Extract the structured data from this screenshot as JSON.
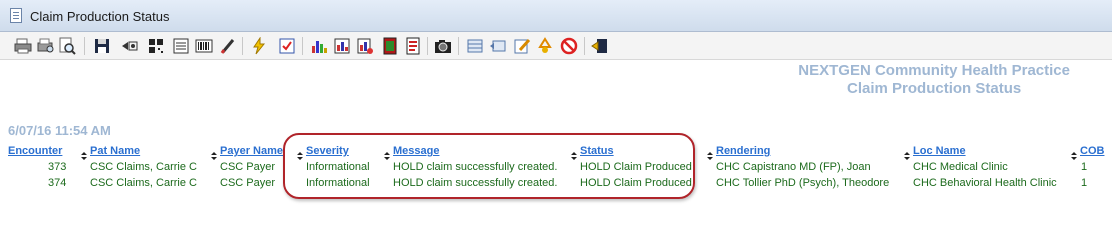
{
  "window": {
    "title": "Claim Production Status"
  },
  "toolbar": {
    "icons": [
      "print-icon",
      "print-preview-icon",
      "search-icon",
      "save-icon",
      "export-icon",
      "qr-icon",
      "report-icon",
      "barcode-icon",
      "brush-icon",
      "lightning-icon",
      "checklist-icon",
      "bar-chart-icon",
      "report-chart-icon",
      "report-chart-2-icon",
      "red-book-icon",
      "red-document-icon",
      "camera-icon",
      "grid-icon",
      "view-icon",
      "edit-icon",
      "recycle-icon",
      "stop-icon",
      "export-window-icon"
    ]
  },
  "report": {
    "practice_name": "NEXTGEN Community Health Practice",
    "report_title": "Claim Production Status",
    "timestamp": "6/07/16 11:54 AM"
  },
  "table": {
    "columns": [
      "Encounter",
      "Pat Name",
      "Payer Name",
      "Severity",
      "Message",
      "Status",
      "Rendering",
      "Loc Name",
      "COB"
    ],
    "rows": [
      [
        "373",
        "CSC Claims, Carrie C",
        "CSC Payer",
        "Informational",
        "HOLD claim successfully created.",
        "HOLD Claim Produced",
        "CHC Capistrano MD (FP), Joan",
        "CHC Medical Clinic",
        "1"
      ],
      [
        "374",
        "CSC Claims, Carrie C",
        "CSC Payer",
        "Informational",
        "HOLD claim successfully created.",
        "HOLD Claim Produced",
        "CHC Tollier PhD (Psych), Theodore",
        "CHC Behavioral Health Clinic",
        "1"
      ]
    ]
  },
  "colors": {
    "header_link": "#2a6fd0",
    "cell_text": "#1c6a1c",
    "report_heading": "#9fb7d3",
    "highlight": "#b0242a"
  }
}
